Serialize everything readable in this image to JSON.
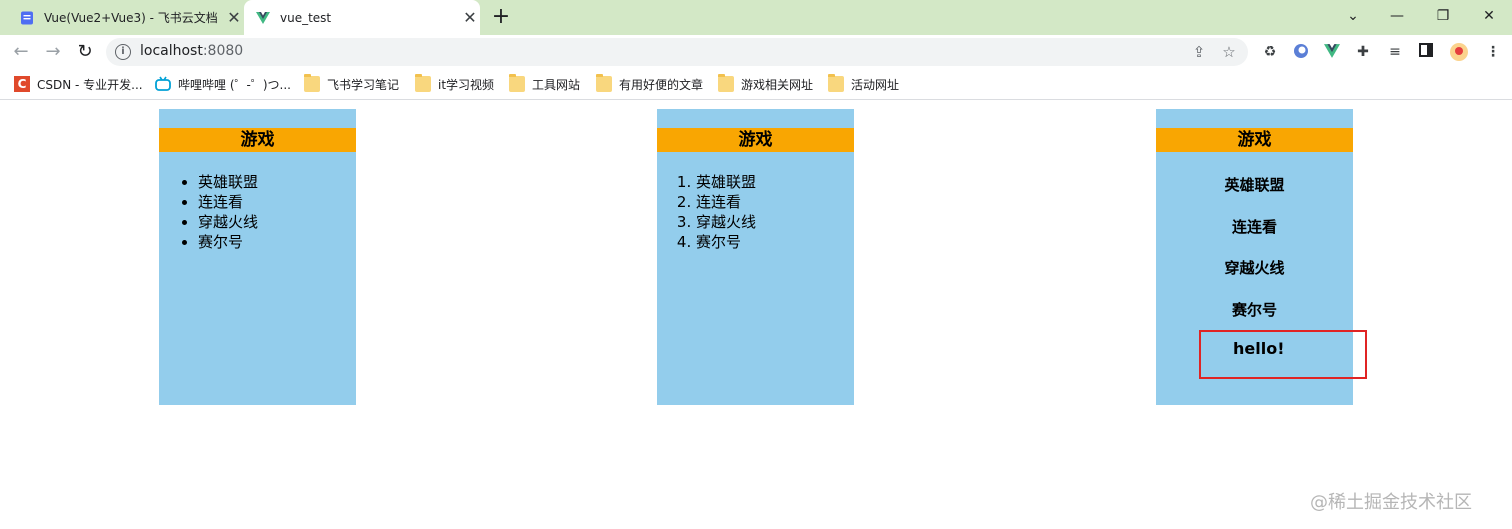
{
  "browser": {
    "tabs": [
      {
        "title": "Vue(Vue2+Vue3) - 飞书云文档",
        "close": "✕"
      },
      {
        "title": "vue_test",
        "close": "✕"
      }
    ],
    "new_tab": "+",
    "window_controls": {
      "chevron": "⌄",
      "minimize": "—",
      "restore": "❐",
      "close": "✕"
    },
    "nav": {
      "back": "←",
      "forward": "→",
      "reload": "↻"
    },
    "address": {
      "host": "localhost",
      "port": ":8080",
      "info": "i"
    },
    "bookmarks": [
      {
        "label": "CSDN - 专业开发..."
      },
      {
        "label": "哔哩哔哩 (゜-゜)つ..."
      },
      {
        "label": "飞书学习笔记"
      },
      {
        "label": "it学习视频"
      },
      {
        "label": "工具网站"
      },
      {
        "label": "有用好便的文章"
      },
      {
        "label": "游戏相关网址"
      },
      {
        "label": "活动网址"
      }
    ]
  },
  "page": {
    "cards": [
      {
        "title": "游戏",
        "items": [
          "英雄联盟",
          "连连看",
          "穿越火线",
          "赛尔号"
        ]
      },
      {
        "title": "游戏",
        "items": [
          "英雄联盟",
          "连连看",
          "穿越火线",
          "赛尔号"
        ]
      },
      {
        "title": "游戏",
        "items": [
          "英雄联盟",
          "连连看",
          "穿越火线",
          "赛尔号"
        ],
        "extra": "hello!"
      }
    ],
    "watermark": "@稀土掘金技术社区"
  },
  "colors": {
    "card_bg": "#93cdec",
    "card_header": "#f9a602",
    "tab_strip": "#d3e8c6",
    "highlight_border": "#e02424"
  }
}
